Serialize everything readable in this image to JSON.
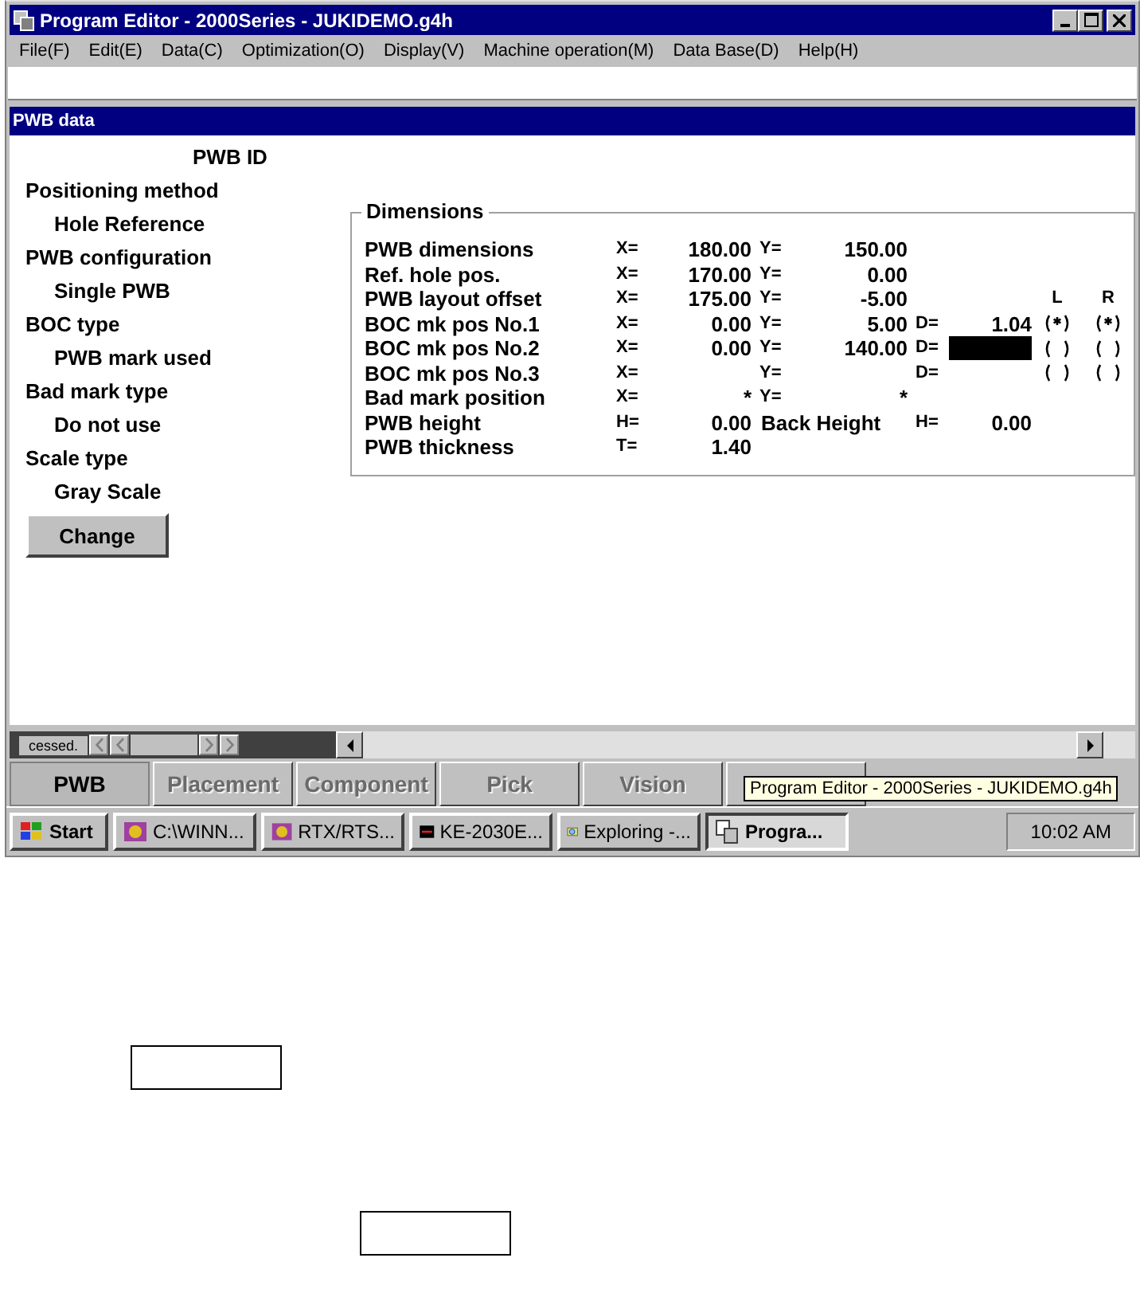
{
  "window": {
    "title": "Program Editor - 2000Series - JUKIDEMO.g4h"
  },
  "menu": [
    "File(F)",
    "Edit(E)",
    "Data(C)",
    "Optimization(O)",
    "Display(V)",
    "Machine operation(M)",
    "Data Base(D)",
    "Help(H)"
  ],
  "child_window": {
    "title": "PWB data"
  },
  "pwb_id": "PWB ID",
  "settings": [
    {
      "label": "Positioning method",
      "value": "Hole Reference"
    },
    {
      "label": "PWB configuration",
      "value": "Single PWB"
    },
    {
      "label": "BOC type",
      "value": "PWB mark used"
    },
    {
      "label": "Bad mark type",
      "value": "Do not use"
    },
    {
      "label": "Scale type",
      "value": "Gray Scale"
    }
  ],
  "change_button": "Change",
  "dimensions": {
    "title": "Dimensions",
    "rows": [
      {
        "label": "PWB dimensions",
        "x": {
          "label": "X=",
          "value": "180.00"
        },
        "y": {
          "label": "Y=",
          "value": "150.00"
        }
      },
      {
        "label": "Ref. hole pos.",
        "x": {
          "label": "X=",
          "value": "170.00"
        },
        "y": {
          "label": "Y=",
          "value": "0.00"
        }
      },
      {
        "label": "PWB layout offset",
        "x": {
          "label": "X=",
          "value": "175.00"
        },
        "y": {
          "label": "Y=",
          "value": "-5.00"
        },
        "lr_header": [
          "L",
          "R"
        ]
      },
      {
        "label": "BOC mk pos No.1",
        "x": {
          "label": "X=",
          "value": "0.00"
        },
        "y": {
          "label": "Y=",
          "value": "5.00"
        },
        "d": {
          "label": "D=",
          "value": "1.04"
        },
        "marks": [
          {
            "checked": true
          },
          {
            "checked": true
          }
        ]
      },
      {
        "label": "BOC mk pos No.2",
        "x": {
          "label": "X=",
          "value": "0.00"
        },
        "y": {
          "label": "Y=",
          "value": "140.00"
        },
        "d": {
          "label": "D=",
          "focused": true
        },
        "marks": [
          {
            "checked": false
          },
          {
            "checked": false
          }
        ]
      },
      {
        "label": "BOC mk pos No.3",
        "x": {
          "label": "X="
        },
        "y": {
          "label": "Y="
        },
        "d": {
          "label": "D="
        },
        "marks": [
          {
            "checked": false
          },
          {
            "checked": false
          }
        ]
      },
      {
        "label": "Bad mark position",
        "x": {
          "label": "X=",
          "value": "*"
        },
        "y": {
          "label": "Y=",
          "value": "*"
        }
      },
      {
        "label": "PWB height",
        "x": {
          "label": "H=",
          "value": "0.00"
        },
        "y": {
          "label": "Back Height",
          "kind": "caption"
        },
        "d": {
          "label": "H=",
          "value": "0.00"
        }
      },
      {
        "label": "PWB thickness",
        "x": {
          "label": "T=",
          "value": "1.40"
        }
      }
    ]
  },
  "sheet_nav": "cessed.",
  "tabs": [
    {
      "label": "PWB",
      "selected": true,
      "disabled": false
    },
    {
      "label": "Placement",
      "selected": false,
      "disabled": true
    },
    {
      "label": "Component",
      "selected": false,
      "disabled": true
    },
    {
      "label": "Pick",
      "selected": false,
      "disabled": true
    },
    {
      "label": "Vision",
      "selected": false,
      "disabled": true
    },
    {
      "selected": false
    }
  ],
  "tooltip": "Program Editor - 2000Series - JUKIDEMO.g4h",
  "taskbar": {
    "start": "Start",
    "buttons": [
      {
        "label": "C:\\WINN...",
        "kind": "app",
        "selected": false
      },
      {
        "label": "RTX/RTS...",
        "kind": "app",
        "selected": false
      },
      {
        "label": "KE-2030E...",
        "kind": "machine",
        "selected": false
      },
      {
        "label": "Exploring -...",
        "kind": "explorer",
        "selected": false
      },
      {
        "label": "Progra...",
        "kind": "editor",
        "selected": true
      }
    ],
    "clock": "10:02 AM"
  },
  "document": {
    "boxes": [
      {
        "kind": "blank"
      },
      {
        "kind": "blank"
      }
    ]
  }
}
